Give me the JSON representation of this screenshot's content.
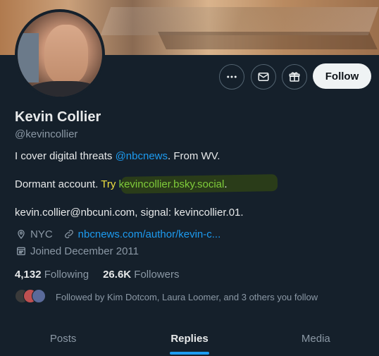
{
  "profile": {
    "name": "Kevin Collier",
    "handle": "@kevincollier",
    "bio_line1_prefix": "I cover digital threats ",
    "bio_line1_link": "@nbcnews",
    "bio_line1_suffix": ". From WV.",
    "bio_line2_prefix": "Dormant account. ",
    "bio_line2_try": "Try",
    "bio_line2_link": "kevincollier.bsky.social",
    "bio_line2_suffix": ".",
    "bio_line3": "kevin.collier@nbcuni.com, signal: kevincollier.01.",
    "location": "NYC",
    "website": "nbcnews.com/author/kevin-c...",
    "joined": "Joined December 2011"
  },
  "actions": {
    "more_icon": "more-icon",
    "message_icon": "envelope-icon",
    "subscribe_icon": "gift-icon",
    "follow_label": "Follow"
  },
  "stats": {
    "following_count": "4,132",
    "following_label": "Following",
    "followers_count": "26.6K",
    "followers_label": "Followers"
  },
  "followed_by": "Followed by Kim Dotcom, Laura Loomer, and 3 others you follow",
  "tabs": [
    {
      "label": "Posts",
      "active": false
    },
    {
      "label": "Replies",
      "active": true
    },
    {
      "label": "Media",
      "active": false
    }
  ],
  "colors": {
    "background": "#15202b",
    "accent": "#1d9bf0",
    "text_primary": "#e7e9ea",
    "text_secondary": "#8b98a5",
    "highlight_yellow": "#f0e040",
    "highlight_green": "#7fcc3a"
  }
}
